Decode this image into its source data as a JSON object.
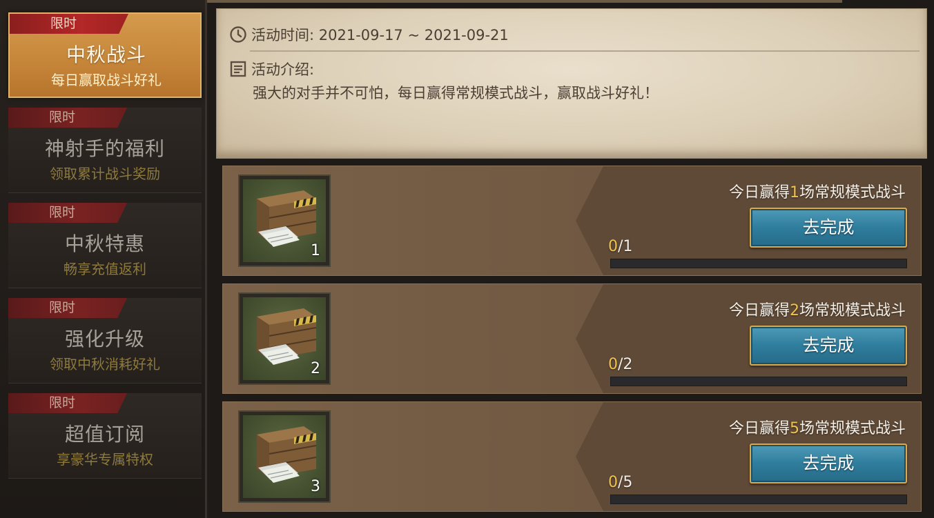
{
  "sidebar": {
    "items": [
      {
        "tag": "限时",
        "title": "中秋战斗",
        "subtitle": "每日赢取战斗好礼",
        "active": true
      },
      {
        "tag": "限时",
        "title": "神射手的福利",
        "subtitle": "领取累计战斗奖励",
        "active": false
      },
      {
        "tag": "限时",
        "title": "中秋特惠",
        "subtitle": "畅享充值返利",
        "active": false
      },
      {
        "tag": "限时",
        "title": "强化升级",
        "subtitle": "领取中秋消耗好礼",
        "active": false
      },
      {
        "tag": "限时",
        "title": "超值订阅",
        "subtitle": "享豪华专属特权",
        "active": false
      }
    ]
  },
  "info": {
    "time_label": "活动时间: 2021-09-17 ~ 2021-09-21",
    "intro_label": "活动介绍:",
    "intro_text": "强大的对手并不可怕，每日赢得常规模式战斗，赢取战斗好礼！",
    "clock_icon": "clock-icon",
    "doc_icon": "document-icon"
  },
  "tasks": [
    {
      "label_prefix": "今日赢得",
      "count": "1",
      "label_suffix": "场常规模式战斗",
      "button": "去完成",
      "progress_current": "0",
      "progress_total": "/1",
      "progress_fraction": 0,
      "reward_count": "1",
      "reward_icon": "supply-crate-icon"
    },
    {
      "label_prefix": "今日赢得",
      "count": "2",
      "label_suffix": "场常规模式战斗",
      "button": "去完成",
      "progress_current": "0",
      "progress_total": "/2",
      "progress_fraction": 0,
      "reward_count": "2",
      "reward_icon": "supply-crate-icon"
    },
    {
      "label_prefix": "今日赢得",
      "count": "5",
      "label_suffix": "场常规模式战斗",
      "button": "去完成",
      "progress_current": "0",
      "progress_total": "/5",
      "progress_fraction": 0,
      "reward_count": "3",
      "reward_icon": "supply-crate-icon"
    }
  ],
  "colors": {
    "accent_gold": "#f0c24e",
    "button_blue": "#2f7d9d",
    "active_tab": "#c7873a",
    "tag_red": "#b32727"
  }
}
